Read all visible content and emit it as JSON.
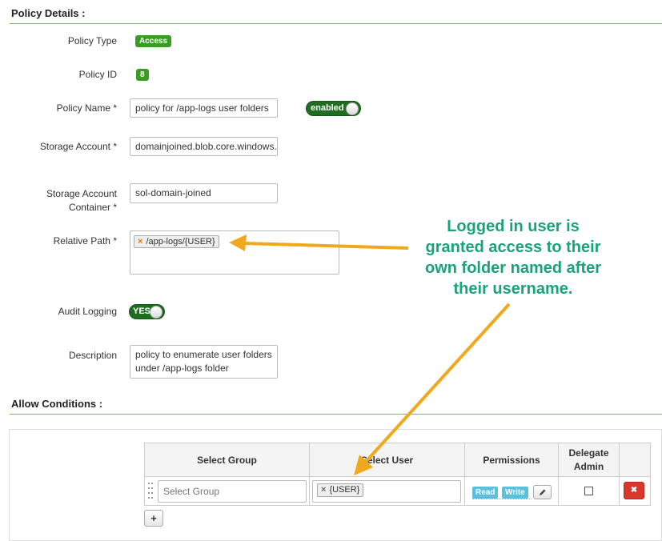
{
  "policy_details": {
    "title": "Policy Details :",
    "policy_type": {
      "label": "Policy Type",
      "value": "Access"
    },
    "policy_id": {
      "label": "Policy ID",
      "value": "8"
    },
    "policy_name": {
      "label": "Policy Name *",
      "value": "policy for /app-logs user folders",
      "toggle": "enabled"
    },
    "storage_account": {
      "label": "Storage Account *",
      "value": "domainjoined.blob.core.windows."
    },
    "container": {
      "label_line1": "Storage Account",
      "label_line2": "Container *",
      "value": "sol-domain-joined"
    },
    "relative_path": {
      "label": "Relative Path *",
      "tag": "/app-logs/{USER}",
      "remove_symbol": "×"
    },
    "audit_logging": {
      "label": "Audit Logging",
      "toggle": "YES"
    },
    "description": {
      "label": "Description",
      "line1": "policy to enumerate user folders",
      "line2": "under /app-logs folder"
    }
  },
  "allow_conditions": {
    "title": "Allow Conditions :",
    "columns": {
      "group": "Select Group",
      "user": "Select User",
      "permissions": "Permissions",
      "delegate_line1": "Delegate",
      "delegate_line2": "Admin"
    },
    "row": {
      "group_placeholder": "Select Group",
      "user_tag": "{USER}",
      "remove_symbol": "×",
      "permissions": [
        "Read",
        "Write"
      ],
      "delete_symbol": "✖",
      "delegate_checked": false
    },
    "add_symbol": "+"
  },
  "annotation": {
    "lines": [
      "Logged in user is",
      "granted access to their",
      "own folder named after",
      "their username."
    ],
    "text_color": "#1aa37a",
    "arrow_color": "#f0a81c"
  },
  "colors": {
    "accent_line": "#8fb457",
    "badge_green": "#3a9d23",
    "toggle_green": "#1f6e1f",
    "permission_blue": "#5bc0de",
    "delete_red": "#d9362c"
  },
  "icons": {
    "edit": "pencil-icon",
    "delete": "times-icon",
    "add": "plus-icon",
    "drag": "drag-handle-icon"
  }
}
